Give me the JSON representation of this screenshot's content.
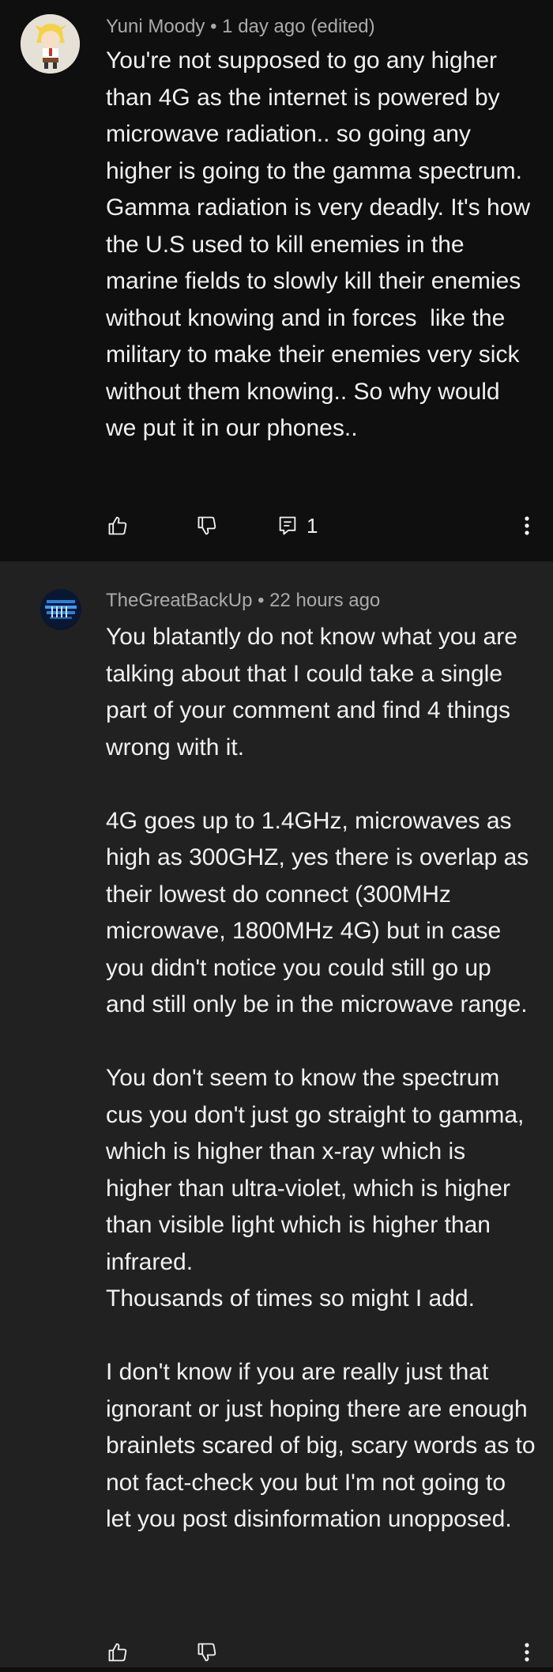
{
  "comments": [
    {
      "author": "Yuni Moody",
      "separator": "•",
      "time": "1 day ago (edited)",
      "text": "You're not supposed to go any higher than 4G as the internet is powered by microwave radiation.. so going any higher is going to the gamma spectrum. Gamma radiation is very deadly. It's how the U.S used to kill enemies in the marine fields to slowly kill their enemies without knowing and in forces  like the military to make their enemies very sick without them knowing.. So why would we put it in our phones..",
      "reply_count": "1",
      "icons": {
        "like": "thumbs-up-icon",
        "dislike": "thumbs-down-icon",
        "reply": "reply-icon",
        "more": "more-vertical-icon"
      }
    },
    {
      "author": "TheGreatBackUp",
      "separator": "•",
      "time": "22 hours ago",
      "text": "You blatantly do not know what you are talking about that I could take a single part of your comment and find 4 things wrong with it.\n\n4G goes up to 1.4GHz, microwaves as high as 300GHZ, yes there is overlap as their lowest do connect (300MHz microwave, 1800MHz 4G) but in case you didn't notice you could still go up and still only be in the microwave range.\n\nYou don't seem to know the spectrum cus you don't just go straight to gamma, which is higher than x-ray which is higher than ultra-violet, which is higher than visible light which is higher than infrared.\nThousands of times so might I add.\n\nI don't know if you are really just that ignorant or just hoping there are enough brainlets scared of big, scary words as to not fact-check you but I'm not going to let you post disinformation unopposed.",
      "icons": {
        "like": "thumbs-up-icon",
        "dislike": "thumbs-down-icon",
        "more": "more-vertical-icon"
      }
    }
  ],
  "colors": {
    "background_top": "#0f0f0f",
    "background_reply": "#212121",
    "text": "#f1f1f1",
    "meta": "#aaaaaa"
  }
}
